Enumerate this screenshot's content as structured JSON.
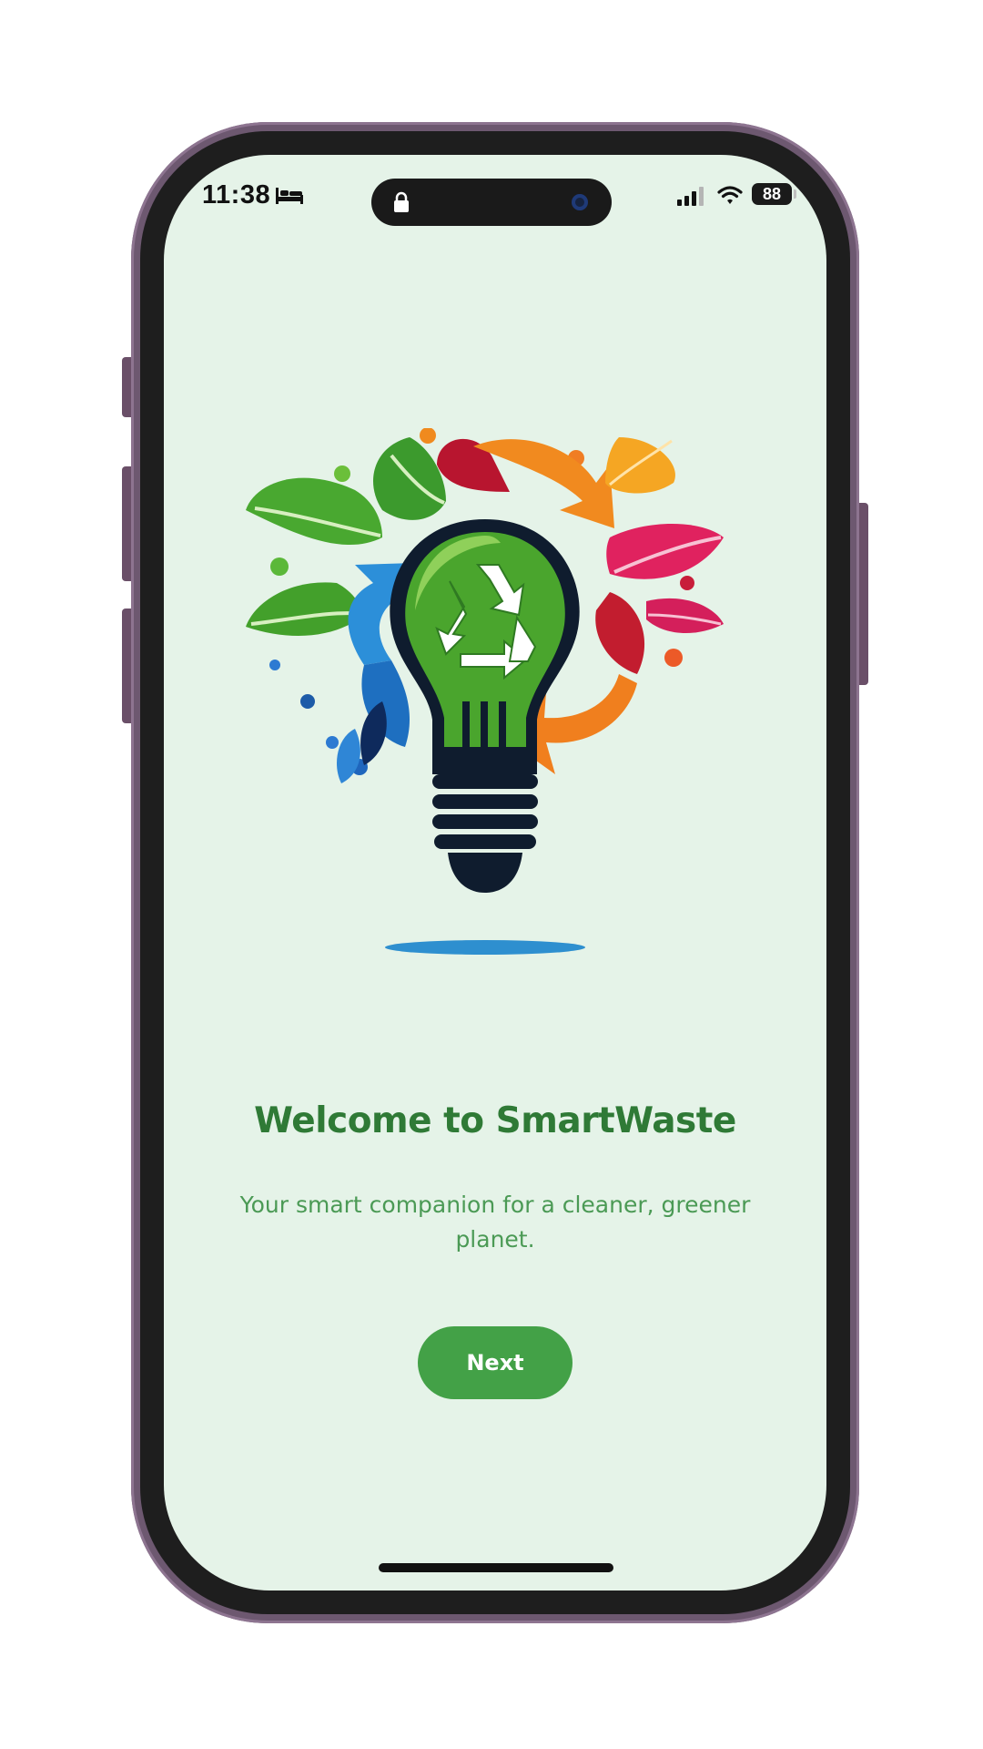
{
  "status_bar": {
    "time": "11:38",
    "battery_level": "88",
    "icons": [
      "bed-icon",
      "lock-icon",
      "camera-icon",
      "signal-icon",
      "wifi-icon",
      "battery-icon"
    ]
  },
  "welcome": {
    "logo_icon": "lightbulb-recycle-icon",
    "title": "Welcome to SmartWaste",
    "subtitle": "Your smart companion for a cleaner, greener planet.",
    "next_label": "Next"
  },
  "colors": {
    "screen_background": "#e5f3e8",
    "title_green": "#2f7a36",
    "subtitle_green": "#4b9a55",
    "button_green": "#43a147",
    "phone_frame": "#6d5870"
  }
}
